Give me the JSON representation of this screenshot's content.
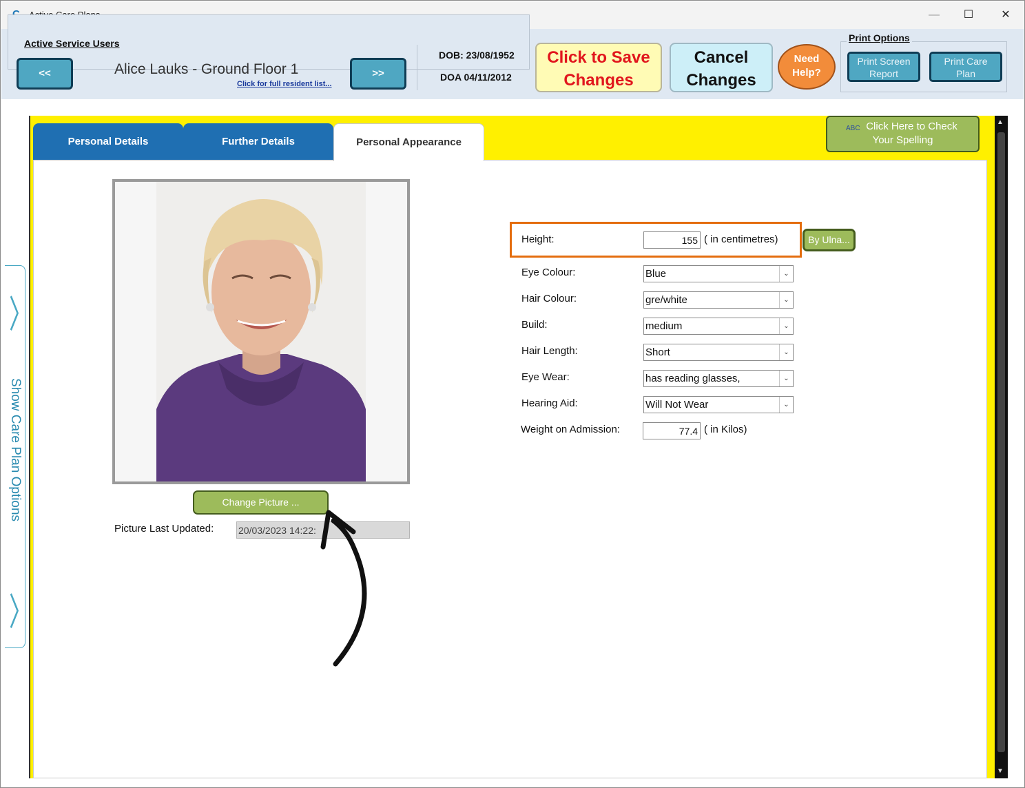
{
  "window": {
    "app_icon": "C",
    "title": "Active Care Plans...",
    "minimize": "—",
    "maximize": "☐",
    "close": "✕"
  },
  "header": {
    "group_label": "Active Service Users",
    "prev_label": "<<",
    "next_label": ">>",
    "resident_name": "Alice Lauks - Ground Floor 1",
    "resident_link": "Click for full resident list...",
    "dob": "DOB: 23/08/1952",
    "doa": "DOA 04/11/2012",
    "save_line1": "Click to Save",
    "save_line2": "Changes",
    "cancel_line1": "Cancel",
    "cancel_line2": "Changes",
    "help_line1": "Need",
    "help_line2": "Help?",
    "print_group_label": "Print Options",
    "print_screen_line1": "Print Screen",
    "print_screen_line2": "Report",
    "print_care_line1": "Print Care",
    "print_care_line2": "Plan"
  },
  "sidebar": {
    "label": "Show Care Plan Options",
    "chevron": "〉"
  },
  "tabs": [
    {
      "label": "Personal Details",
      "active": false
    },
    {
      "label": "Further Details",
      "active": false
    },
    {
      "label": "Personal Appearance",
      "active": true
    }
  ],
  "spelling": {
    "line1": "Click Here to Check",
    "line2": "Your Spelling",
    "icon": "ABC"
  },
  "photo": {
    "change_label": "Change Picture ...",
    "updated_label": "Picture Last Updated:",
    "updated_value": "20/03/2023 14:22:"
  },
  "form": {
    "height_label": "Height:",
    "height_value": "155",
    "height_unit": "( in centimetres)",
    "ulna_label": "By Ulna...",
    "eye_colour_label": "Eye Colour:",
    "eye_colour_value": "Blue",
    "hair_colour_label": "Hair Colour:",
    "hair_colour_value": "gre/white",
    "build_label": "Build:",
    "build_value": "medium",
    "hair_length_label": "Hair Length:",
    "hair_length_value": "Short",
    "eye_wear_label": "Eye Wear:",
    "eye_wear_value": "has reading glasses,",
    "hearing_aid_label": "Hearing Aid:",
    "hearing_aid_value": "Will Not Wear",
    "weight_label": "Weight on Admission:",
    "weight_value": "77.4",
    "weight_unit": "( in Kilos)"
  },
  "colors": {
    "accent_yellow": "#fff000",
    "tab_blue": "#1f6fb2",
    "button_green": "#9dbb5b",
    "button_teal": "#4fa7c2",
    "save_red": "#e1161d",
    "highlight_orange": "#e46d0e"
  }
}
